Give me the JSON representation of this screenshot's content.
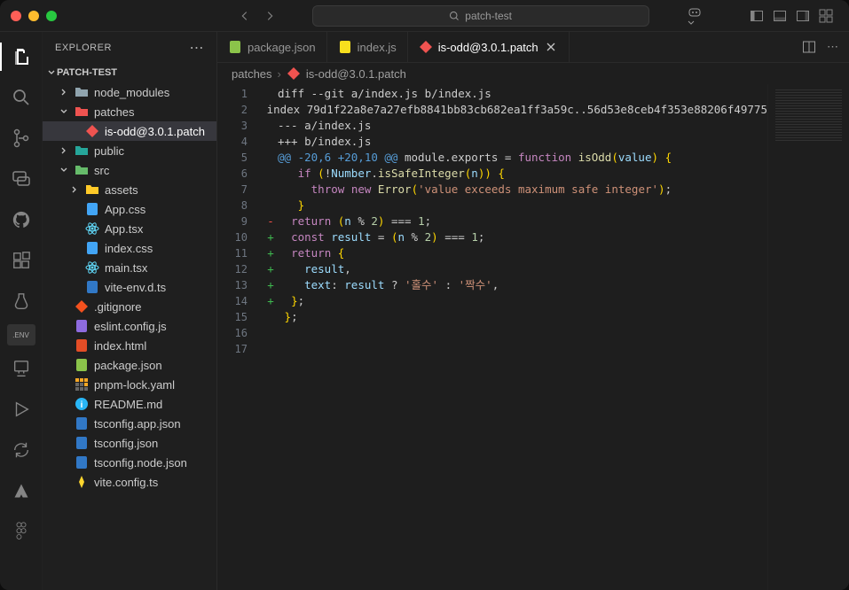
{
  "window": {
    "search_placeholder": "patch-test"
  },
  "sidebar": {
    "title": "EXPLORER",
    "root": "PATCH-TEST",
    "items": [
      {
        "name": "node_modules",
        "kind": "folder-closed",
        "depth": 1,
        "icon": "folder-grey"
      },
      {
        "name": "patches",
        "kind": "folder-open",
        "depth": 1,
        "icon": "folder-red"
      },
      {
        "name": "is-odd@3.0.1.patch",
        "kind": "file",
        "depth": 2,
        "icon": "diff-red",
        "selected": true
      },
      {
        "name": "public",
        "kind": "folder-closed",
        "depth": 1,
        "icon": "folder-teal"
      },
      {
        "name": "src",
        "kind": "folder-open",
        "depth": 1,
        "icon": "folder-green"
      },
      {
        "name": "assets",
        "kind": "folder-closed",
        "depth": 2,
        "icon": "folder-yellow"
      },
      {
        "name": "App.css",
        "kind": "file",
        "depth": 2,
        "icon": "css-blue"
      },
      {
        "name": "App.tsx",
        "kind": "file",
        "depth": 2,
        "icon": "react-blue"
      },
      {
        "name": "index.css",
        "kind": "file",
        "depth": 2,
        "icon": "css-blue"
      },
      {
        "name": "main.tsx",
        "kind": "file",
        "depth": 2,
        "icon": "react-blue"
      },
      {
        "name": "vite-env.d.ts",
        "kind": "file",
        "depth": 2,
        "icon": "ts-blue"
      },
      {
        "name": ".gitignore",
        "kind": "file",
        "depth": 1,
        "icon": "git-orange"
      },
      {
        "name": "eslint.config.js",
        "kind": "file",
        "depth": 1,
        "icon": "eslint-purple"
      },
      {
        "name": "index.html",
        "kind": "file",
        "depth": 1,
        "icon": "html-orange"
      },
      {
        "name": "package.json",
        "kind": "file",
        "depth": 1,
        "icon": "npm-green"
      },
      {
        "name": "pnpm-lock.yaml",
        "kind": "file",
        "depth": 1,
        "icon": "pnpm-yellow"
      },
      {
        "name": "README.md",
        "kind": "file",
        "depth": 1,
        "icon": "info-blue"
      },
      {
        "name": "tsconfig.app.json",
        "kind": "file",
        "depth": 1,
        "icon": "tsconfig-blue"
      },
      {
        "name": "tsconfig.json",
        "kind": "file",
        "depth": 1,
        "icon": "tsconfig-blue"
      },
      {
        "name": "tsconfig.node.json",
        "kind": "file",
        "depth": 1,
        "icon": "tsconfig-blue"
      },
      {
        "name": "vite.config.ts",
        "kind": "file",
        "depth": 1,
        "icon": "vite-yellow"
      }
    ]
  },
  "tabs": [
    {
      "label": "package.json",
      "icon": "npm-green",
      "active": false,
      "closeable": false
    },
    {
      "label": "index.js",
      "icon": "js-yellow",
      "active": false,
      "closeable": false
    },
    {
      "label": "is-odd@3.0.1.patch",
      "icon": "diff-red",
      "active": true,
      "closeable": true
    }
  ],
  "breadcrumb": [
    {
      "label": "patches",
      "icon": null
    },
    {
      "label": "is-odd@3.0.1.patch",
      "icon": "diff-red"
    }
  ],
  "code": {
    "lines": [
      {
        "n": 1,
        "sign": "",
        "html": "diff --git a/index.js b/index.js"
      },
      {
        "n": 2,
        "sign": "",
        "html": "index 79d1f22a8e7a27efb8841bb83cb682ea1ff3a59c..56d53e8ceb4f353e88206f49775"
      },
      {
        "n": 3,
        "sign": "",
        "html": "--- a/index.js"
      },
      {
        "n": 4,
        "sign": "",
        "html": "+++ b/index.js"
      },
      {
        "n": 5,
        "sign": "",
        "html": "<span class='tok-meta'>@@ -20,6 +20,10 @@</span> module.exports = <span class='tok-kw'>function</span> <span class='tok-fn'>isOdd</span><span class='tok-punc'>(</span><span class='tok-var'>value</span><span class='tok-punc'>)</span> <span class='tok-punc'>{</span>"
      },
      {
        "n": 6,
        "sign": "",
        "html": "   <span class='tok-kw'>if</span> <span class='tok-punc'>(</span>!<span class='tok-var'>Number</span>.<span class='tok-fn'>isSafeInteger</span><span class='tok-punc'>(</span><span class='tok-var'>n</span><span class='tok-punc'>))</span> <span class='tok-punc'>{</span>"
      },
      {
        "n": 7,
        "sign": "",
        "html": "     <span class='tok-kw'>throw</span> <span class='tok-kw'>new</span> <span class='tok-fn'>Error</span><span class='tok-punc'>(</span><span class='tok-str'>'value exceeds maximum safe integer'</span><span class='tok-punc'>)</span>;"
      },
      {
        "n": 8,
        "sign": "",
        "html": "   <span class='tok-punc'>}</span>"
      },
      {
        "n": 9,
        "sign": "-",
        "html": "  <span class='tok-kw'>return</span> <span class='tok-punc'>(</span><span class='tok-var'>n</span> % <span class='tok-num'>2</span><span class='tok-punc'>)</span> === <span class='tok-num'>1</span>;"
      },
      {
        "n": 10,
        "sign": "+",
        "html": "  <span class='tok-kw'>const</span> <span class='tok-var'>result</span> = <span class='tok-punc'>(</span><span class='tok-var'>n</span> % <span class='tok-num'>2</span><span class='tok-punc'>)</span> === <span class='tok-num'>1</span>;"
      },
      {
        "n": 11,
        "sign": "+",
        "html": "  <span class='tok-kw'>return</span> <span class='tok-punc'>{</span>"
      },
      {
        "n": 12,
        "sign": "+",
        "html": "    <span class='tok-var'>result</span>,"
      },
      {
        "n": 13,
        "sign": "+",
        "html": "    <span class='tok-var'>text</span>: <span class='tok-var'>result</span> ? <span class='tok-str'>'홀수'</span> : <span class='tok-str'>'짝수'</span>,"
      },
      {
        "n": 14,
        "sign": "+",
        "html": "  <span class='tok-punc'>}</span>;"
      },
      {
        "n": 15,
        "sign": "",
        "html": " <span class='tok-punc'>}</span>;"
      },
      {
        "n": 16,
        "sign": "",
        "html": ""
      },
      {
        "n": 17,
        "sign": "",
        "html": ""
      }
    ]
  },
  "icons": {
    "search": "⌕",
    "copilot": "⌘"
  }
}
